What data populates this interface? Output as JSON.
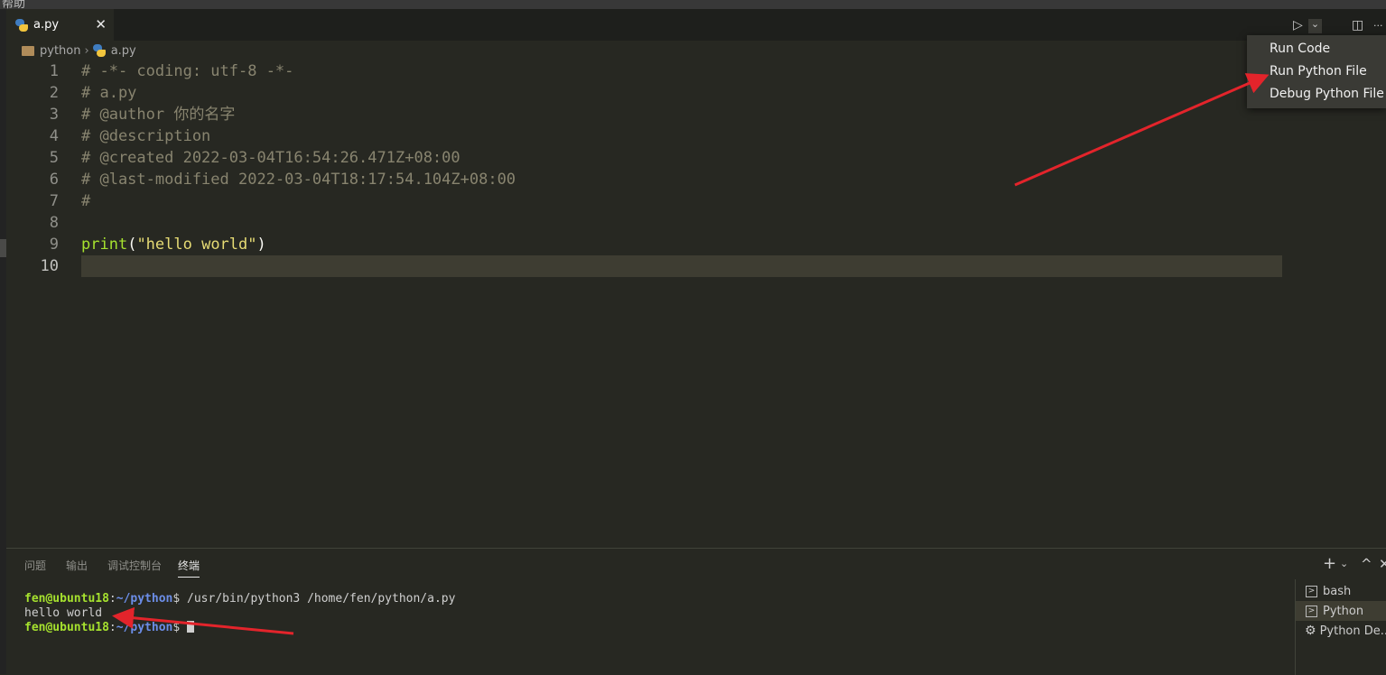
{
  "window": {
    "top_text": "帮助"
  },
  "tab": {
    "label": "a.py",
    "close_glyph": "✕"
  },
  "toolbar": {
    "run_glyph": "▷",
    "dropdown_glyph": "⌄",
    "split_glyph": "◫",
    "more_glyph": "···"
  },
  "breadcrumb": {
    "folder": "python",
    "separator": "›",
    "file": "a.py"
  },
  "editor": {
    "lines": [
      {
        "num": "1",
        "text": "# -*- coding: utf-8 -*-"
      },
      {
        "num": "2",
        "text": "# a.py"
      },
      {
        "num": "3",
        "text": "# @author 你的名字"
      },
      {
        "num": "4",
        "text": "# @description"
      },
      {
        "num": "5",
        "text": "# @created 2022-03-04T16:54:26.471Z+08:00"
      },
      {
        "num": "6",
        "text": "# @last-modified 2022-03-04T18:17:54.104Z+08:00"
      },
      {
        "num": "7",
        "text": "#"
      },
      {
        "num": "8",
        "text": ""
      },
      {
        "num": "9",
        "fn": "print",
        "open": "(",
        "str": "\"hello world\"",
        "close": ")"
      },
      {
        "num": "10",
        "text": ""
      }
    ]
  },
  "run_menu": {
    "items": [
      "Run Code",
      "Run Python File",
      "Debug Python File"
    ]
  },
  "panel": {
    "tabs": [
      "问题",
      "输出",
      "调试控制台",
      "终端"
    ],
    "active_tab": "终端",
    "controls": {
      "add": "+",
      "dropdown": "⌄",
      "maximize": "^",
      "close": "✕"
    },
    "terminal": {
      "line1_user": "fen@ubuntu18",
      "line1_colon": ":",
      "line1_path": "~/python",
      "line1_cmd": "$ /usr/bin/python3 /home/fen/python/a.py",
      "line2": "hello world",
      "line3_user": "fen@ubuntu18",
      "line3_colon": ":",
      "line3_path": "~/python",
      "line3_prompt": "$ "
    },
    "terminal_list": [
      {
        "label": "bash",
        "icon": ">"
      },
      {
        "label": "Python",
        "icon": ">"
      },
      {
        "label": "Python De...",
        "icon": "⚙"
      }
    ]
  },
  "colors": {
    "annotation_arrow": "#e3242b",
    "editor_bg": "#272822",
    "current_line": "#3e3d32"
  }
}
